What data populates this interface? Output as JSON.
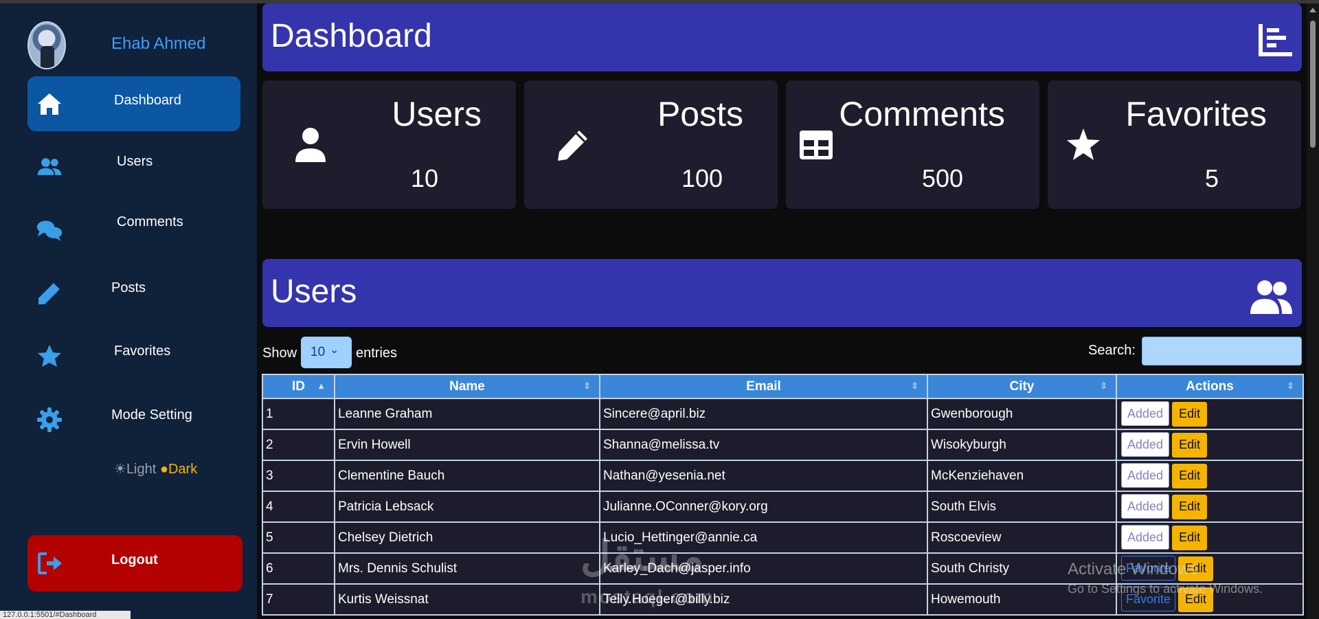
{
  "colors": {
    "accent_header": "#3434ad",
    "sidebar_bg": "#10213a",
    "active_nav": "#0b57a4",
    "logout": "#b30000",
    "table_header": "#3a86d8",
    "edit_button": "#f5b400",
    "card_bg": "#1e1d2d"
  },
  "sidebar": {
    "user_name": "Ehab Ahmed",
    "items": [
      {
        "label": "Dashboard",
        "icon": "home-icon"
      },
      {
        "label": "Users",
        "icon": "users-icon"
      },
      {
        "label": "Comments",
        "icon": "comments-icon"
      },
      {
        "label": "Posts",
        "icon": "pencil-icon"
      },
      {
        "label": "Favorites",
        "icon": "star-icon"
      },
      {
        "label": "Mode Setting",
        "icon": "gear-icon"
      }
    ],
    "mode": {
      "light": "Light",
      "dark": "Dark"
    },
    "logout_label": "Logout"
  },
  "dashboard": {
    "title": "Dashboard",
    "cards": [
      {
        "title": "Users",
        "value": "10",
        "icon": "user-icon"
      },
      {
        "title": "Posts",
        "value": "100",
        "icon": "pencil-icon"
      },
      {
        "title": "Comments",
        "value": "500",
        "icon": "table-icon"
      },
      {
        "title": "Favorites",
        "value": "5",
        "icon": "star-icon"
      }
    ]
  },
  "users_section": {
    "title": "Users",
    "show_label": "Show",
    "length_value": "10",
    "entries_label": "entries",
    "search_label": "Search:",
    "columns": [
      "ID",
      "Name",
      "Email",
      "City",
      "Actions"
    ],
    "rows": [
      {
        "id": "1",
        "name": "Leanne Graham",
        "email": "Sincere@april.biz",
        "city": "Gwenborough",
        "status": "Added",
        "edit": "Edit"
      },
      {
        "id": "2",
        "name": "Ervin Howell",
        "email": "Shanna@melissa.tv",
        "city": "Wisokyburgh",
        "status": "Added",
        "edit": "Edit"
      },
      {
        "id": "3",
        "name": "Clementine Bauch",
        "email": "Nathan@yesenia.net",
        "city": "McKenziehaven",
        "status": "Added",
        "edit": "Edit"
      },
      {
        "id": "4",
        "name": "Patricia Lebsack",
        "email": "Julianne.OConner@kory.org",
        "city": "South Elvis",
        "status": "Added",
        "edit": "Edit"
      },
      {
        "id": "5",
        "name": "Chelsey Dietrich",
        "email": "Lucio_Hettinger@annie.ca",
        "city": "Roscoeview",
        "status": "Added",
        "edit": "Edit"
      },
      {
        "id": "6",
        "name": "Mrs. Dennis Schulist",
        "email": "Karley_Dach@jasper.info",
        "city": "South Christy",
        "status": "Favorite",
        "edit": "Edit"
      },
      {
        "id": "7",
        "name": "Kurtis Weissnat",
        "email": "Telly.Hoeger@billy.biz",
        "city": "Howemouth",
        "status": "Favorite",
        "edit": "Edit"
      }
    ]
  },
  "overlay": {
    "watermark": "مستقل",
    "watermark_sub": "mostaql.com",
    "activate_title": "Activate Windows",
    "activate_sub": "Go to Settings to activate Windows."
  },
  "status_url": "127.0.0.1:5501/#Dashboard"
}
